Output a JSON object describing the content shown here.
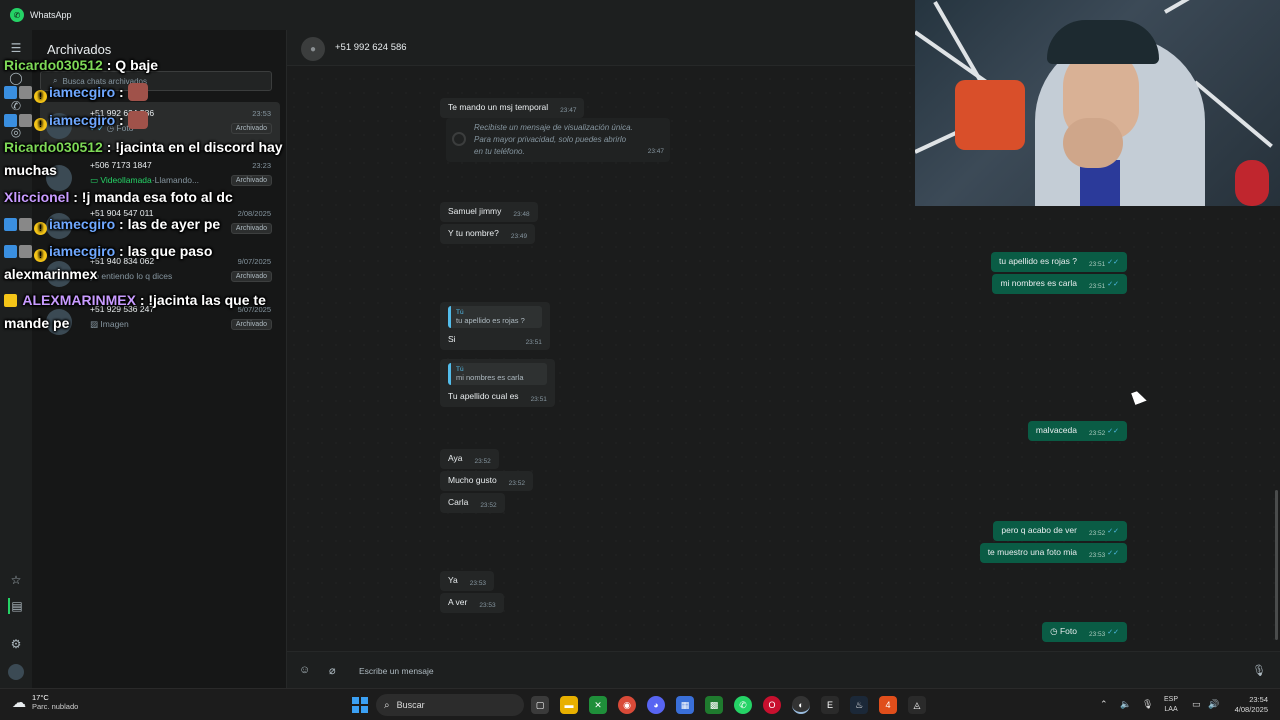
{
  "window": {
    "title": "WhatsApp",
    "icon": "whatsapp-icon"
  },
  "rail": {
    "icons": [
      "menu-icon",
      "chats-icon",
      "calls-icon",
      "status-icon",
      "starred-icon",
      "archive-icon",
      "settings-icon",
      "profile-icon"
    ]
  },
  "sidebar": {
    "header": "Archivados",
    "search_placeholder": "Busca chats archivados",
    "chats": [
      {
        "name": "+51 992 624 586",
        "time": "23:53",
        "preview": "Foto",
        "badge": "Archivado",
        "active": true
      },
      {
        "name": "+506 7173 1847",
        "time": "23:23",
        "preview_hl": "Videollamada",
        "preview": "Llamando...",
        "badge": "Archivado"
      },
      {
        "name": "+51 904 547 011",
        "time": "2/08/2025",
        "preview": "",
        "badge": "Archivado"
      },
      {
        "name": "+51 940 834 062",
        "time": "9/07/2025",
        "preview": "yo entiendo lo q dices",
        "badge": "Archivado"
      },
      {
        "name": "+51 929 536 247",
        "time": "5/07/2025",
        "preview": "Imagen",
        "badge": "Archivado"
      }
    ]
  },
  "conversation": {
    "contact": "+51 992 624 586",
    "incoming": [
      {
        "text": "Te mando un msj temporal",
        "time": "23:47"
      },
      {
        "text": "Samuel jimmy",
        "time": "23:48"
      },
      {
        "text": "Y tu nombre?",
        "time": "23:49"
      },
      {
        "text": "Si",
        "time": "23:51",
        "quote_who": "Tú",
        "quote": "tu apellido es rojas ?"
      },
      {
        "text": "Tu apellido cual es",
        "time": "23:51",
        "quote_who": "Tú",
        "quote": "mi nombres es carla"
      },
      {
        "text": "Aya",
        "time": "23:52"
      },
      {
        "text": "Mucho gusto",
        "time": "23:52"
      },
      {
        "text": "Carla",
        "time": "23:52"
      },
      {
        "text": "Ya",
        "time": "23:53"
      },
      {
        "text": "A ver",
        "time": "23:53"
      }
    ],
    "view_once": {
      "line1": "Recibiste un mensaje de visualización única.",
      "line2": "Para mayor privacidad, solo puedes abrirlo",
      "line3": "en tu teléfono.",
      "time": "23:47"
    },
    "outgoing": [
      {
        "text": "tu apellido es rojas ?",
        "time": "23:51"
      },
      {
        "text": "mi nombres es carla",
        "time": "23:51"
      },
      {
        "text": "malvaceda",
        "time": "23:52"
      },
      {
        "text": "pero q acabo de ver",
        "time": "23:52"
      },
      {
        "text": "te muestro una foto mia",
        "time": "23:53"
      },
      {
        "text": "Foto",
        "time": "23:53"
      }
    ],
    "composer_placeholder": "Escribe un mensaje"
  },
  "stream_chat": [
    {
      "user": "Ricardo030512",
      "msg": ": Q baje"
    },
    {
      "user": "iamecgiro",
      "msg": ":"
    },
    {
      "user": "iamecgiro",
      "msg": ":"
    },
    {
      "user": "Ricardo030512",
      "msg": ": !jacinta en el discord hay",
      "msg2": "muchas"
    },
    {
      "user": "Xliccionel",
      "msg": ": !j manda esa foto al dc"
    },
    {
      "user": "iamecgiro",
      "msg": ": las de ayer pe"
    },
    {
      "user": "iamecgiro",
      "msg": ": las que paso",
      "msg2": "alexmarinmex"
    },
    {
      "user": "ALEXMARINMEX",
      "msg": ": !jacinta las que te",
      "msg2": "mande pe"
    }
  ],
  "taskbar": {
    "weather_temp": "17°C",
    "weather_desc": "Parc. nublado",
    "search": "Buscar",
    "lang1": "ESP",
    "lang2": "LAA",
    "time": "23:54",
    "date": "4/08/2025"
  }
}
